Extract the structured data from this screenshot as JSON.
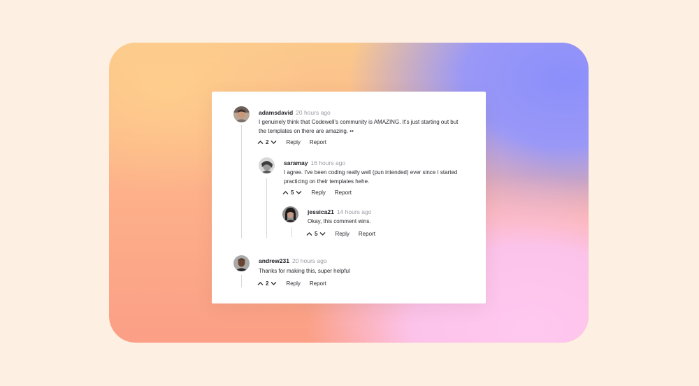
{
  "comments": [
    {
      "author": "adamsdavid",
      "time": "20 hours ago",
      "text_line1": "I genuinely think that Codewell's community is AMAZING. It's just starting out but",
      "text_line2": "the templates on there are amazing. ••",
      "votes": "2",
      "reply_label": "Reply",
      "report_label": "Report",
      "replies": [
        {
          "author": "saramay",
          "time": "16 hours ago",
          "text_line1": "I agree. I've been coding really well (pun intended) ever since I started",
          "text_line2": "practicing on their templates hehe.",
          "votes": "5",
          "reply_label": "Reply",
          "report_label": "Report",
          "replies": [
            {
              "author": "jessica21",
              "time": "14 hours ago",
              "text_line1": "Okay, this comment wins.",
              "votes": "5",
              "reply_label": "Reply",
              "report_label": "Report"
            }
          ]
        }
      ]
    },
    {
      "author": "andrew231",
      "time": "20 hours ago",
      "text_line1": "Thanks for making this, super helpful",
      "votes": "2",
      "reply_label": "Reply",
      "report_label": "Report"
    }
  ],
  "icons": {
    "upvote": "chevron-up-icon",
    "downvote": "chevron-down-icon"
  },
  "colors": {
    "page_background": "#fdefe1",
    "card": "#ffffff",
    "text": "#2a2a30",
    "muted": "#9b9ba3",
    "thread_line": "#d9d9de"
  }
}
